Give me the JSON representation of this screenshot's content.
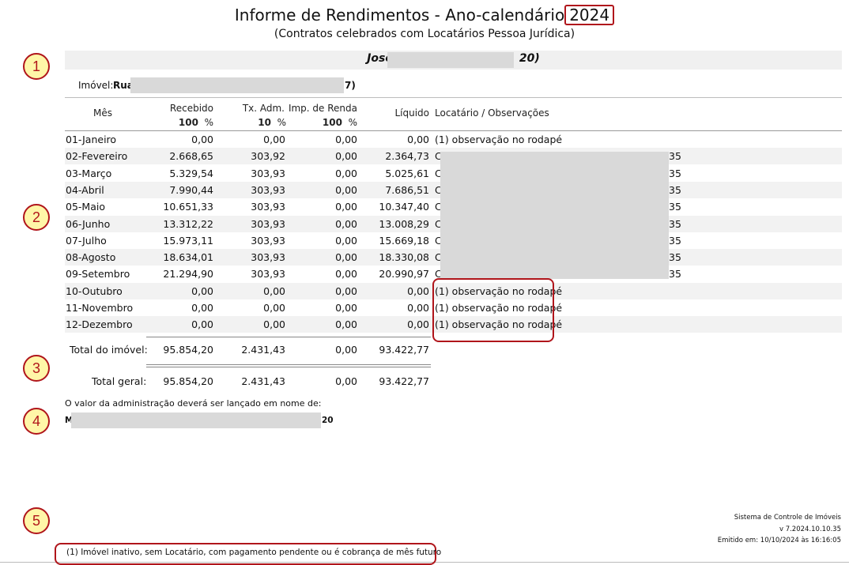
{
  "header": {
    "title": "Informe de Rendimentos - Ano-calendário",
    "year": "2024",
    "subtitle": "(Contratos celebrados com Locatários Pessoa Jurídica)"
  },
  "owner": {
    "name_start": "Jose",
    "name_end": "20)"
  },
  "property": {
    "label": "Imóvel:",
    "value_start": "Rua",
    "value_end": "7)"
  },
  "columns": {
    "mes": "Mês",
    "recebido": "Recebido",
    "recebido_pct": "100",
    "tx_adm": "Tx. Adm.",
    "tx_adm_pct": "10",
    "imp_renda": "Imp. de Renda",
    "imp_renda_pct": "100",
    "pct_sign": "%",
    "liquido": "Líquido",
    "locatario": "Locatário / Observações"
  },
  "rows": [
    {
      "mes": "01-Janeiro",
      "recebido": "0,00",
      "tx": "0,00",
      "imp": "0,00",
      "liq": "0,00",
      "obs": "(1) observação no rodapé"
    },
    {
      "mes": "02-Fevereiro",
      "recebido": "2.668,65",
      "tx": "303,92",
      "imp": "0,00",
      "liq": "2.364,73",
      "obs": "C",
      "obs_end": "35"
    },
    {
      "mes": "03-Março",
      "recebido": "5.329,54",
      "tx": "303,93",
      "imp": "0,00",
      "liq": "5.025,61",
      "obs": "C",
      "obs_end": "35"
    },
    {
      "mes": "04-Abril",
      "recebido": "7.990,44",
      "tx": "303,93",
      "imp": "0,00",
      "liq": "7.686,51",
      "obs": "C",
      "obs_end": "35"
    },
    {
      "mes": "05-Maio",
      "recebido": "10.651,33",
      "tx": "303,93",
      "imp": "0,00",
      "liq": "10.347,40",
      "obs": "C",
      "obs_end": "35"
    },
    {
      "mes": "06-Junho",
      "recebido": "13.312,22",
      "tx": "303,93",
      "imp": "0,00",
      "liq": "13.008,29",
      "obs": "C",
      "obs_end": "35"
    },
    {
      "mes": "07-Julho",
      "recebido": "15.973,11",
      "tx": "303,93",
      "imp": "0,00",
      "liq": "15.669,18",
      "obs": "C",
      "obs_end": "35"
    },
    {
      "mes": "08-Agosto",
      "recebido": "18.634,01",
      "tx": "303,93",
      "imp": "0,00",
      "liq": "18.330,08",
      "obs": "C",
      "obs_end": "35"
    },
    {
      "mes": "09-Setembro",
      "recebido": "21.294,90",
      "tx": "303,93",
      "imp": "0,00",
      "liq": "20.990,97",
      "obs": "C",
      "obs_end": "35"
    },
    {
      "mes": "10-Outubro",
      "recebido": "0,00",
      "tx": "0,00",
      "imp": "0,00",
      "liq": "0,00",
      "obs": "(1) observação no rodapé"
    },
    {
      "mes": "11-Novembro",
      "recebido": "0,00",
      "tx": "0,00",
      "imp": "0,00",
      "liq": "0,00",
      "obs": "(1) observação no rodapé"
    },
    {
      "mes": "12-Dezembro",
      "recebido": "0,00",
      "tx": "0,00",
      "imp": "0,00",
      "liq": "0,00",
      "obs": "(1) observação no rodapé"
    }
  ],
  "total_imovel": {
    "label": "Total do imóvel:",
    "recebido": "95.854,20",
    "tx": "2.431,43",
    "imp": "0,00",
    "liq": "93.422,77"
  },
  "total_geral": {
    "label": "Total geral:",
    "recebido": "95.854,20",
    "tx": "2.431,43",
    "imp": "0,00",
    "liq": "93.422,77"
  },
  "admin_note": {
    "text": "O valor da administração deverá ser lançado em nome de:",
    "name_start": "M",
    "name_end": "20"
  },
  "footer": {
    "note": "(1)  Imóvel inativo, sem Locatário, com pagamento pendente ou é cobrança de mês futuro",
    "system": "Sistema de Controle de Imóveis",
    "version": "v 7.2024.10.10.35",
    "emitted": "Emitido em: 10/10/2024 às 16:16:05"
  },
  "markers": [
    "1",
    "2",
    "3",
    "4",
    "5"
  ],
  "colors": {
    "accent": "#b0151b",
    "marker_fill": "#fff6a8",
    "redaction": "#d9d9d9"
  }
}
